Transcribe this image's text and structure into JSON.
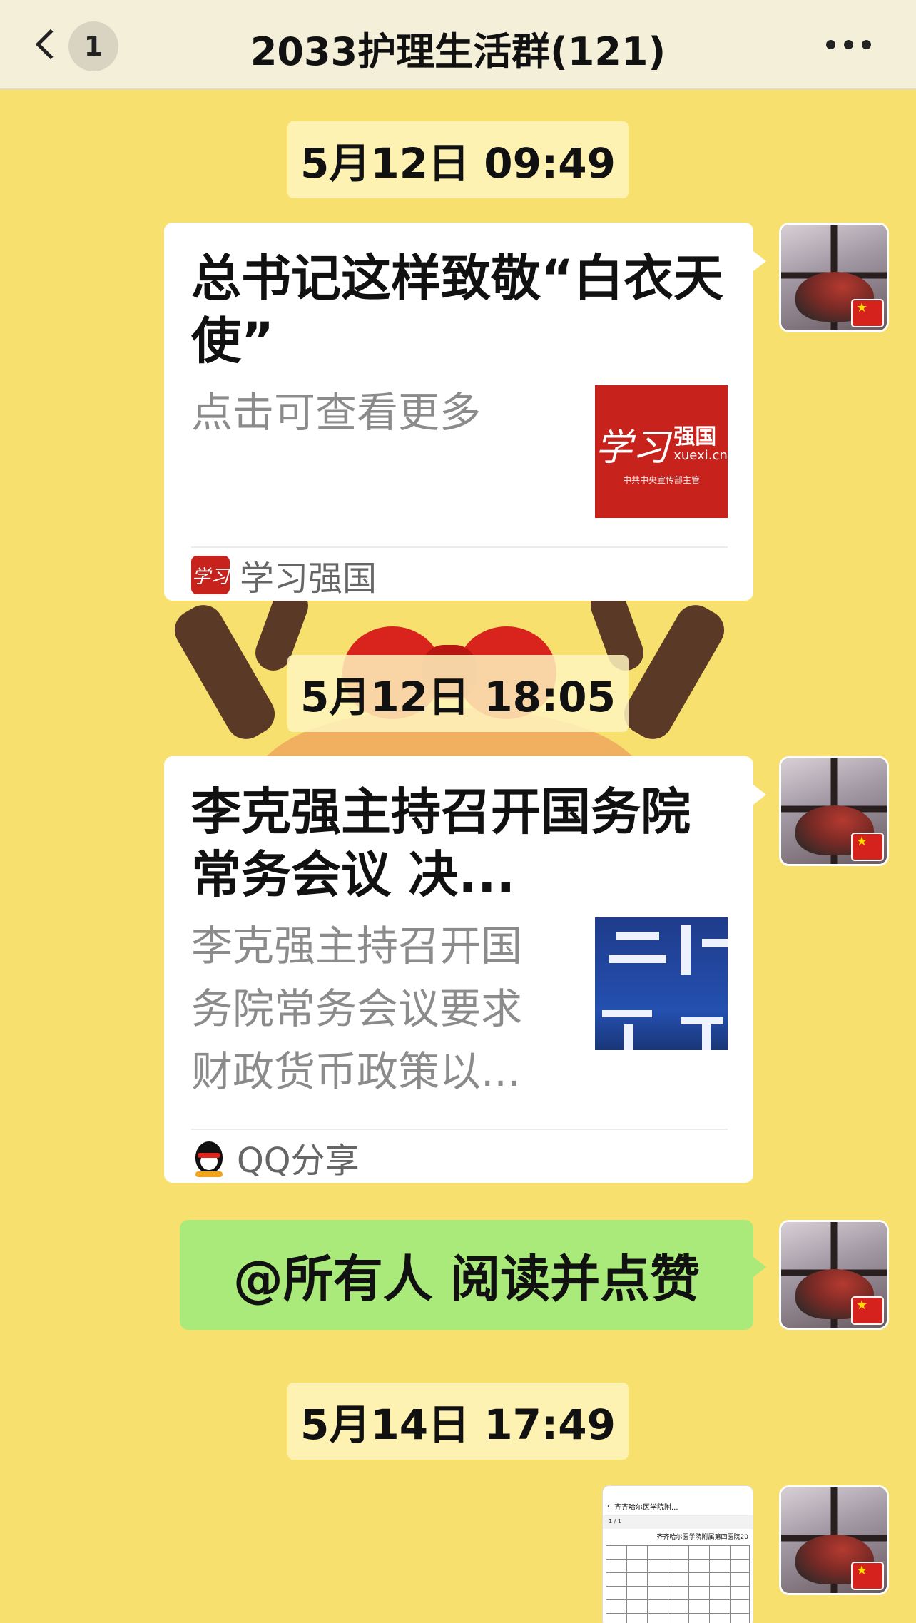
{
  "header": {
    "unread_count": "1",
    "title": "2033护理生活群(121)"
  },
  "timestamps": [
    "5月12日 09:49",
    "5月12日 18:05",
    "5月14日 17:49"
  ],
  "cards": [
    {
      "title": "总书记这样致敬“白衣天使”",
      "desc": "点击可查看更多",
      "source": "学习强国",
      "thumb": {
        "logo_script": "学习",
        "logo_main": "强国",
        "logo_url": "xuexi.cn",
        "logo_sub": "中共中央宣传部主管"
      }
    },
    {
      "title": "李克强主持召开国务院常务会议 决...",
      "desc": "李克强主持召开国务院常务会议要求财政货币政策以...",
      "source": "QQ分享"
    }
  ],
  "text_message": "@所有人 阅读并点赞",
  "image_message": {
    "nav_title": "齐齐哈尔医学院附...",
    "page_indicator": "1 / 1",
    "doc_title": "齐齐哈尔医学院附属第四医院20"
  },
  "icons": {
    "back": "chevron-left-icon",
    "more": "ellipsis-icon",
    "avatar": "avatar-with-flag",
    "qq": "qq-penguin-icon",
    "xuexi": "xuexi-logo-icon"
  },
  "colors": {
    "background": "#f8e06e",
    "header": "#f3efd9",
    "bubble_green": "#a9ea7a",
    "xuexi_red": "#c8221c"
  }
}
